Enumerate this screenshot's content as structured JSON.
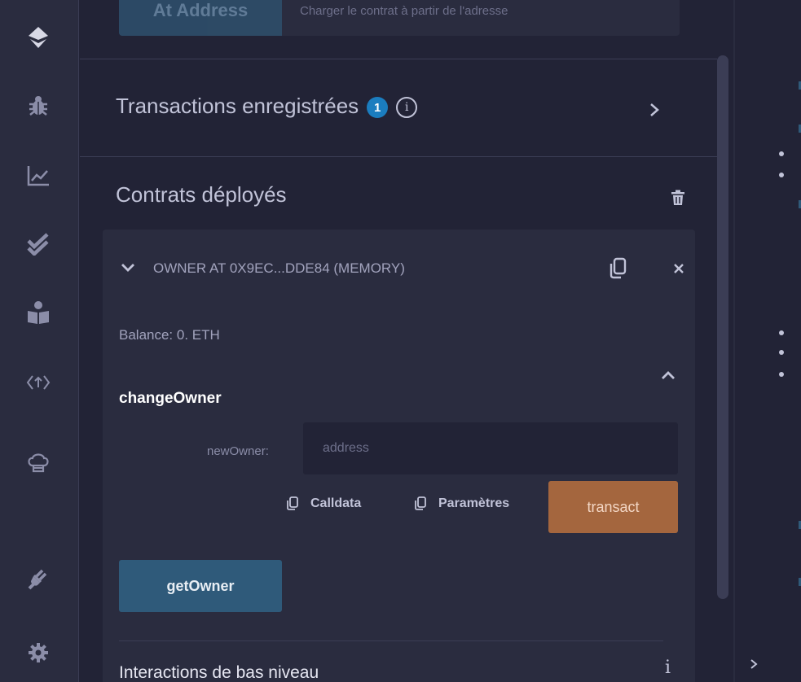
{
  "rail": {
    "icons": [
      "remix-logo-icon",
      "bug-icon",
      "chart-icon",
      "double-check-icon",
      "learn-icon",
      "api-icon",
      "chef-hat-icon",
      "plugin-icon",
      "gear-icon"
    ]
  },
  "at_address": {
    "button_label": "At Address",
    "hint": "Charger le contrat à partir de l'adresse"
  },
  "recorded": {
    "title": "Transactions enregistrées",
    "count": "1",
    "info": "i"
  },
  "deployed": {
    "title": "Contrats déployés",
    "instance": {
      "header": "OWNER AT 0X9EC...DDE84 (MEMORY)",
      "balance": "Balance: 0. ETH",
      "function_name": "changeOwner",
      "param_label": "newOwner:",
      "param_placeholder": "address",
      "calldata_label": "Calldata",
      "params_label": "Paramètres",
      "transact_label": "transact",
      "getter_label": "getOwner",
      "low_level_title": "Interactions de bas niveau",
      "low_level_info": "i"
    }
  },
  "colors": {
    "accent_blue": "#2f5a7a",
    "transact_orange": "#a4663e",
    "badge_blue": "#1b7dbf"
  }
}
